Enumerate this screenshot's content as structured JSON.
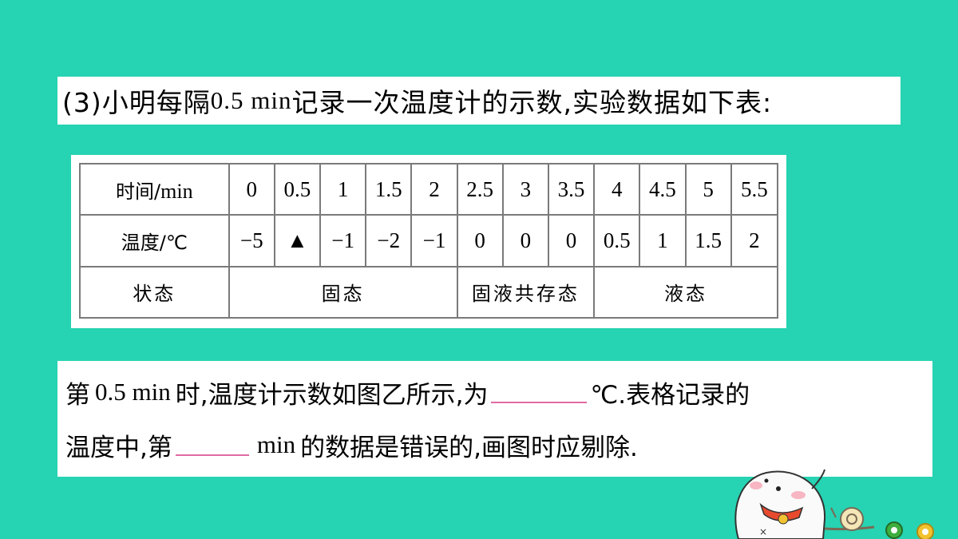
{
  "header": {
    "prefix": "(3)小明每隔 ",
    "latin": "0.5 min",
    "suffix": " 记录一次温度计的示数,实验数据如下表:"
  },
  "table": {
    "time_label_cn": "时间/",
    "time_label_unit": "min",
    "times": [
      "0",
      "0.5",
      "1",
      "1.5",
      "2",
      "2.5",
      "3",
      "3.5",
      "4",
      "4.5",
      "5",
      "5.5"
    ],
    "temp_label": "温度/℃",
    "temps": [
      "−5",
      "▲",
      "−1",
      "−2",
      "−1",
      "0",
      "0",
      "0",
      "0.5",
      "1",
      "1.5",
      "2"
    ],
    "state_label": "状态",
    "states": [
      "固态",
      "固液共存态",
      "液态"
    ]
  },
  "question": {
    "line1_part1": "第",
    "line1_latin": "0.5 min",
    "line1_part2": "时,温度计示数如图乙所示,为",
    "line1_part3": "℃.表格记录的",
    "line2_part1": "温度中,第",
    "line2_latin": "min",
    "line2_part2": "的数据是错误的,画图时应剔除."
  },
  "colors": {
    "background": "#26d3b2",
    "blank_underline": "#e06aa2"
  }
}
